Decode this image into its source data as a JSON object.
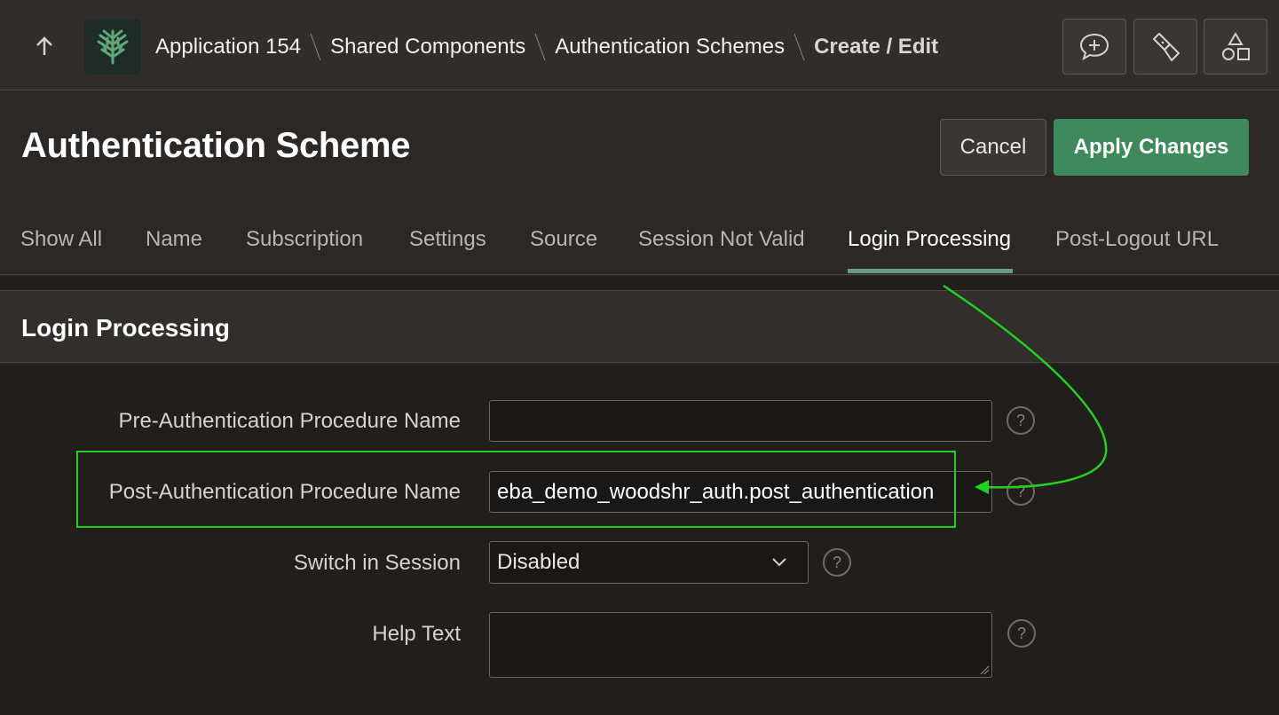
{
  "breadcrumb": {
    "items": [
      "Application 154",
      "Shared Components",
      "Authentication Schemes"
    ],
    "current": "Create / Edit"
  },
  "toolbar": {
    "up_icon": "arrow-up-icon",
    "logo_icon": "tree-logo-icon",
    "buttons": [
      "comment-add-icon",
      "flashlight-icon",
      "shapes-icon"
    ]
  },
  "page": {
    "title": "Authentication Scheme",
    "cancel_label": "Cancel",
    "apply_label": "Apply Changes"
  },
  "tabs": [
    {
      "label": "Show All"
    },
    {
      "label": "Name"
    },
    {
      "label": "Subscription"
    },
    {
      "label": "Settings"
    },
    {
      "label": "Source"
    },
    {
      "label": "Session Not Valid"
    },
    {
      "label": "Login Processing",
      "active": true
    },
    {
      "label": "Post-Logout URL"
    }
  ],
  "region": {
    "title": "Login Processing",
    "fields": {
      "pre_auth": {
        "label": "Pre-Authentication Procedure Name",
        "value": ""
      },
      "post_auth": {
        "label": "Post-Authentication Procedure Name",
        "value": "eba_demo_woodshr_auth.post_authentication"
      },
      "switch_session": {
        "label": "Switch in Session",
        "value": "Disabled"
      },
      "help_text": {
        "label": "Help Text",
        "value": ""
      }
    },
    "help_symbol": "?"
  },
  "colors": {
    "accent_green": "#3e8a5c",
    "tab_underline": "#6b9a7c",
    "annotation_green": "#22d022"
  }
}
